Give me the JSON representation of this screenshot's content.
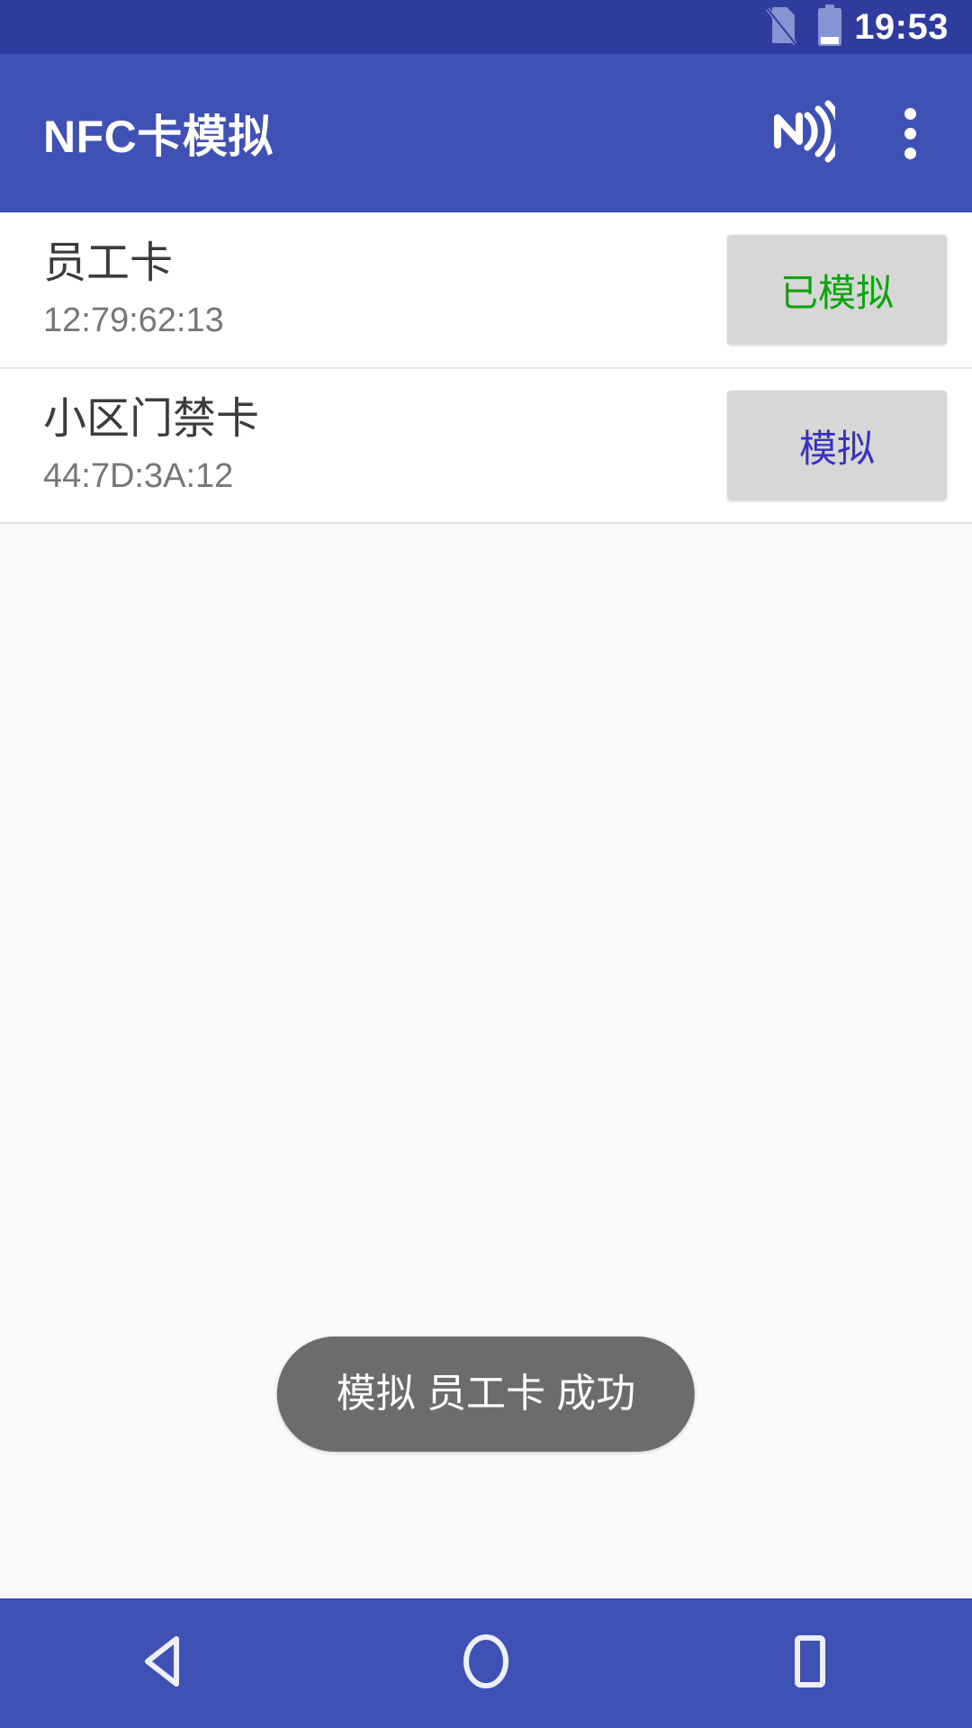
{
  "status_bar": {
    "clock": "19:53",
    "icons": [
      {
        "name": "no-sim-icon"
      },
      {
        "name": "battery-icon"
      }
    ],
    "background_color": "#2F3C9E"
  },
  "app_bar": {
    "title": "NFC卡模拟",
    "background_color": "#3F51B5",
    "title_color": "#FFFFFF",
    "actions": [
      {
        "name": "nfc-icon",
        "label": "NFC"
      },
      {
        "name": "overflow-menu-icon",
        "label": "更多选项"
      }
    ]
  },
  "card_list": [
    {
      "title": "员工卡",
      "uid": "12:79:62:13",
      "action_label": "已模拟",
      "action_state": "emulated",
      "action_color": "#10A310"
    },
    {
      "title": "小区门禁卡",
      "uid": "44:7D:3A:12",
      "action_label": "模拟",
      "action_state": "idle",
      "action_color": "#3730C4"
    }
  ],
  "toast": {
    "message": "模拟 员工卡 成功",
    "background_color": "#6C6C6C",
    "text_color": "#FFFFFF"
  },
  "nav_bar": {
    "background_color": "#3F51B5",
    "buttons": [
      {
        "name": "nav-back-button",
        "icon": "back-triangle-icon"
      },
      {
        "name": "nav-home-button",
        "icon": "home-circle-icon"
      },
      {
        "name": "nav-recents-button",
        "icon": "recents-square-icon"
      }
    ]
  },
  "theme": {
    "page_background": "#FAFAFA",
    "row_background": "#FFFFFF",
    "divider": "#E6E6E6",
    "button_background": "#D6D7D6",
    "primary_text": "#3C3C3C",
    "secondary_text": "#777777"
  }
}
